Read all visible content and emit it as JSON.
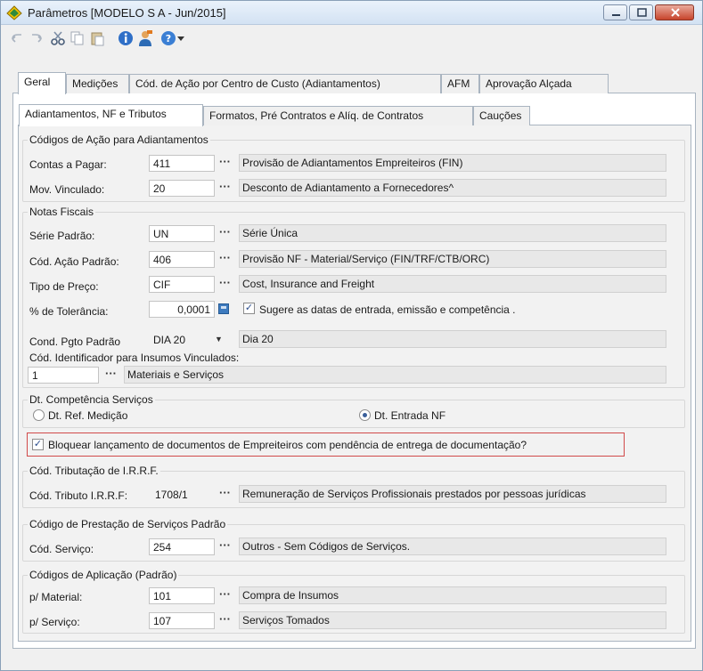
{
  "window": {
    "title": "Parâmetros [MODELO S A - Jun/2015]"
  },
  "toolbar": {
    "icons": [
      "undo-icon",
      "redo-icon",
      "cut-icon",
      "copy-icon",
      "paste-icon",
      "info-icon",
      "user-icon",
      "help-icon",
      "dropdown-arrow-icon"
    ]
  },
  "tabs_main": [
    "Geral",
    "Medições",
    "Cód. de Ação por Centro de Custo (Adiantamentos)",
    "AFM",
    "Aprovação Alçada"
  ],
  "tabs_sub": [
    "Adiantamentos, NF e Tributos",
    "Formatos, Pré Contratos e Alíq. de Contratos",
    "Cauções"
  ],
  "adiantamentos": {
    "title": "Códigos de Ação para Adiantamentos",
    "contas_label": "Contas a Pagar:",
    "contas_code": "411",
    "contas_desc": "Provisão de Adiantamentos Empreiteiros (FIN)",
    "mov_label": "Mov. Vinculado:",
    "mov_code": "20",
    "mov_desc": "Desconto de Adiantamento a Fornecedores^"
  },
  "notas": {
    "title": "Notas Fiscais",
    "serie_label": "Série Padrão:",
    "serie_code": "UN",
    "serie_desc": "Série Única",
    "acao_label": "Cód. Ação Padrão:",
    "acao_code": "406",
    "acao_desc": "Provisão NF - Material/Serviço (FIN/TRF/CTB/ORC)",
    "preco_label": "Tipo de Preço:",
    "preco_code": "CIF",
    "preco_desc": "Cost, Insurance and Freight",
    "tol_label": "% de Tolerância:",
    "tol_value": "0,0001",
    "sugere_check": "✓",
    "sugere_label": "Sugere as datas de entrada, emissão e competência .",
    "pgto_label": "Cond. Pgto Padrão",
    "pgto_code": "DIA 20",
    "pgto_desc": "Dia 20",
    "insumos_label": "Cód. Identificador para Insumos Vinculados:",
    "insumos_code": "1",
    "insumos_desc": "Materiais e Serviços"
  },
  "competencia": {
    "title": "Dt. Competência Serviços",
    "opt1": "Dt. Ref. Medição",
    "opt2": "Dt. Entrada NF"
  },
  "bloquear": {
    "check": "✓",
    "label": "Bloquear lançamento de documentos de Empreiteiros com pendência de entrega de documentação?"
  },
  "irrf": {
    "title": "Cód. Tributação de I.R.R.F.",
    "label": "Cód. Tributo I.R.R.F:",
    "code": "1708/1",
    "desc": "Remuneração de Serviços Profissionais prestados por pessoas jurídicas"
  },
  "prestacao": {
    "title": "Código de Prestação de Serviços Padrão",
    "label": "Cód. Serviço:",
    "code": "254",
    "desc": "Outros - Sem Códigos de Serviços."
  },
  "aplicacao": {
    "title": "Códigos de Aplicação (Padrão)",
    "mat_label": "p/ Material:",
    "mat_code": "101",
    "mat_desc": "Compra de Insumos",
    "serv_label": "p/ Serviço:",
    "serv_code": "107",
    "serv_desc": "Serviços Tomados"
  },
  "ellipsis": "···",
  "combo_arrow": "▼"
}
